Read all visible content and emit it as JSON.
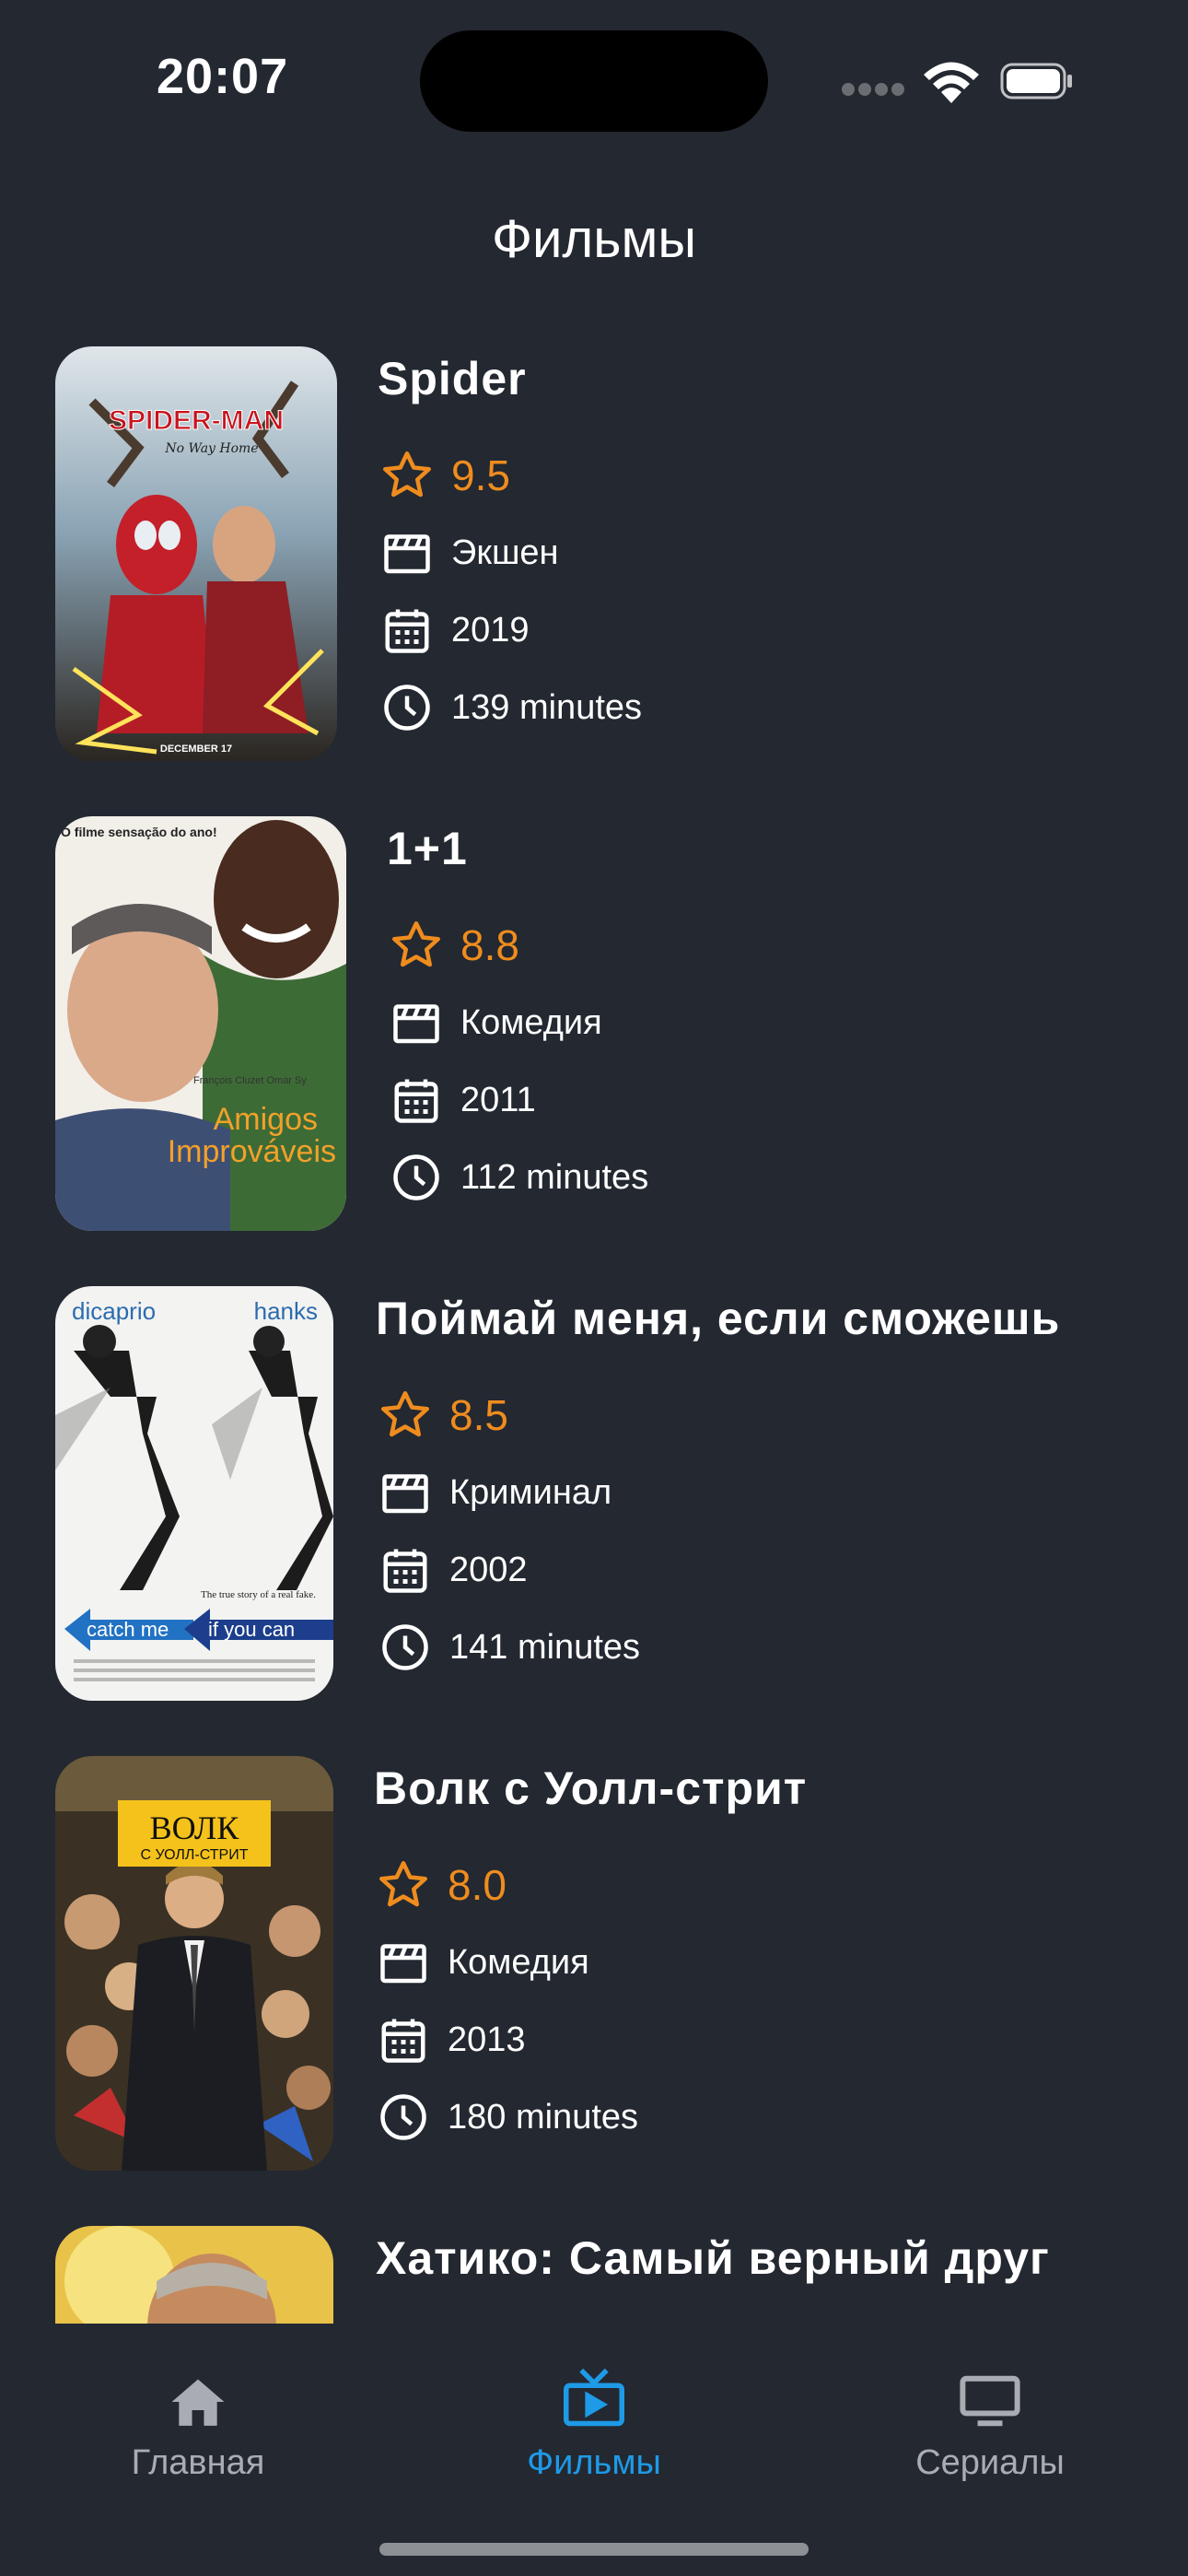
{
  "status_bar": {
    "time": "20:07"
  },
  "header": {
    "title": "Фильмы"
  },
  "colors": {
    "background": "#232831",
    "accent": "#1e9ae6",
    "rating": "#ef8c1e"
  },
  "movies": [
    {
      "title": "Spider",
      "rating": "9.5",
      "genre": "Экшен",
      "year": "2019",
      "duration": "139 minutes",
      "poster": {
        "lines": [
          "SPIDER-MAN",
          "No Way Home",
          "DECEMBER 17"
        ]
      }
    },
    {
      "title": "1+1",
      "rating": "8.8",
      "genre": "Комедия",
      "year": "2011",
      "duration": "112 minutes",
      "poster": {
        "lines": [
          "O filme sensação do ano!",
          "François Cluzet  Omar Sy",
          "Amigos",
          "Improváveis"
        ]
      }
    },
    {
      "title": "Поймай меня, если сможешь",
      "rating": "8.5",
      "genre": "Криминал",
      "year": "2002",
      "duration": "141 minutes",
      "poster": {
        "lines": [
          "dicaprio",
          "hanks",
          "The true story of a real fake.",
          "catch me",
          "if you can"
        ]
      }
    },
    {
      "title": "Волк с Уолл-стрит",
      "rating": "8.0",
      "genre": "Комедия",
      "year": "2013",
      "duration": "180 minutes",
      "poster": {
        "lines": [
          "ВОЛК",
          "С УОЛЛ-СТРИТ"
        ]
      }
    },
    {
      "title": "Хатико: Самый верный друг"
    }
  ],
  "tabs": [
    {
      "label": "Главная",
      "icon": "house-icon",
      "active": false
    },
    {
      "label": "Фильмы",
      "icon": "tv-play-icon",
      "active": true
    },
    {
      "label": "Сериалы",
      "icon": "monitor-icon",
      "active": false
    }
  ]
}
